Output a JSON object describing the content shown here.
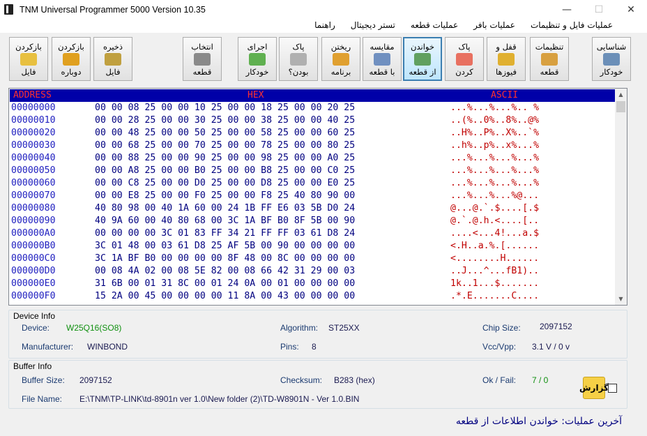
{
  "window": {
    "title": "TNM  Universal Programmer 5000   Version 10.35",
    "minimize_glyph": "—",
    "maximize_glyph": "☐",
    "close_glyph": "✕"
  },
  "menu": {
    "items": [
      "راهنما",
      "تستر دیجیتال",
      "عملیات قطعه",
      "عملیات بافر",
      "عملیات فایل و تنظیمات"
    ]
  },
  "toolbar": {
    "buttons": [
      {
        "l1": "شناسایی",
        "l2": "خودکار",
        "icon": "chip-detect-icon",
        "color": "#6b8fb8"
      },
      {
        "l1": "تنظیمات",
        "l2": "قطعه",
        "icon": "settings-tools-icon",
        "color": "#d8a040"
      },
      {
        "l1": "قفل و",
        "l2": "فیوزها",
        "icon": "lock-icon",
        "color": "#e0b030"
      },
      {
        "l1": "پاک",
        "l2": "کردن",
        "icon": "eraser-icon",
        "color": "#e87060"
      },
      {
        "l1": "خواندن",
        "l2": "از قطعه",
        "icon": "read-chip-icon",
        "color": "#60a060"
      },
      {
        "l1": "مقایسه",
        "l2": "با قطعه",
        "icon": "compare-icon",
        "color": "#7090c0"
      },
      {
        "l1": "ریختن",
        "l2": "برنامه",
        "icon": "write-program-icon",
        "color": "#e0a030"
      },
      {
        "l1": "پاک",
        "l2": "بودن؟",
        "icon": "blank-check-icon",
        "color": "#b0b0b0"
      },
      {
        "l1": "اجرای",
        "l2": "خودکار",
        "icon": "auto-run-icon",
        "color": "#60b050"
      },
      {
        "l1": "انتخاب",
        "l2": "قطعه",
        "icon": "select-chip-icon",
        "color": "#8a8a8a"
      },
      {
        "l1": "ذخیره",
        "l2": "فایل",
        "icon": "save-file-icon",
        "color": "#c0a040"
      },
      {
        "l1": "بازکردن",
        "l2": "دوباره",
        "icon": "reopen-icon",
        "color": "#e0a020"
      },
      {
        "l1": "بازکردن",
        "l2": "فایل",
        "icon": "open-file-icon",
        "color": "#e8c040"
      }
    ]
  },
  "hex_view": {
    "header_address": "ADDRESS",
    "header_hex": "HEX",
    "header_ascii": "ASCII",
    "rows": [
      {
        "addr": "00000000",
        "hex": "00 00 08 25 00 00 10 25 00 00 18 25 00 00 20 25",
        "ascii": "...%...%...%.. %"
      },
      {
        "addr": "00000010",
        "hex": "00 00 28 25 00 00 30 25 00 00 38 25 00 00 40 25",
        "ascii": "..(%..0%..8%..@%"
      },
      {
        "addr": "00000020",
        "hex": "00 00 48 25 00 00 50 25 00 00 58 25 00 00 60 25",
        "ascii": "..H%..P%..X%..`%"
      },
      {
        "addr": "00000030",
        "hex": "00 00 68 25 00 00 70 25 00 00 78 25 00 00 80 25",
        "ascii": "..h%..p%..x%...%"
      },
      {
        "addr": "00000040",
        "hex": "00 00 88 25 00 00 90 25 00 00 98 25 00 00 A0 25",
        "ascii": "...%...%...%...%"
      },
      {
        "addr": "00000050",
        "hex": "00 00 A8 25 00 00 B0 25 00 00 B8 25 00 00 C0 25",
        "ascii": "...%...%...%...%"
      },
      {
        "addr": "00000060",
        "hex": "00 00 C8 25 00 00 D0 25 00 00 D8 25 00 00 E0 25",
        "ascii": "...%...%...%...%"
      },
      {
        "addr": "00000070",
        "hex": "00 00 E8 25 00 00 F0 25 00 00 F8 25 40 80 90 00",
        "ascii": "...%...%...%@..."
      },
      {
        "addr": "00000080",
        "hex": "40 80 98 00 40 1A 60 00 24 1B FF E6 03 5B D0 24",
        "ascii": "@...@.`.$....[.$"
      },
      {
        "addr": "00000090",
        "hex": "40 9A 60 00 40 80 68 00 3C 1A BF B0 8F 5B 00 90",
        "ascii": "@.`.@.h.<....[.."
      },
      {
        "addr": "000000A0",
        "hex": "00 00 00 00 3C 01 83 FF 34 21 FF FF 03 61 D8 24",
        "ascii": "....<...4!...a.$"
      },
      {
        "addr": "000000B0",
        "hex": "3C 01 48 00 03 61 D8 25 AF 5B 00 90 00 00 00 00",
        "ascii": "<.H..a.%.[......"
      },
      {
        "addr": "000000C0",
        "hex": "3C 1A BF B0 00 00 00 00 8F 48 00 8C 00 00 00 00",
        "ascii": "<........H......"
      },
      {
        "addr": "000000D0",
        "hex": "00 08 4A 02 00 08 5E 82 00 08 66 42 31 29 00 03",
        "ascii": "..J...^...fB1).."
      },
      {
        "addr": "000000E0",
        "hex": "31 6B 00 01 31 8C 00 01 24 0A 00 01 00 00 00 00",
        "ascii": "1k..1...$......."
      },
      {
        "addr": "000000F0",
        "hex": "15 2A 00 45 00 00 00 00 11 8A 00 43 00 00 00 00",
        "ascii": ".*.E.......C...."
      }
    ]
  },
  "device_info": {
    "title": "Device Info",
    "device_label": "Device:",
    "device_value": "W25Q16(SO8)",
    "manufacturer_label": "Manufacturer:",
    "manufacturer_value": "WINBOND",
    "algorithm_label": "Algorithm:",
    "algorithm_value": "ST25XX",
    "pins_label": "Pins:",
    "pins_value": "8",
    "chip_size_label": "Chip Size:",
    "chip_size_value": "2097152",
    "vcc_label": "Vcc/Vpp:",
    "vcc_value": "3.1 V / 0 v"
  },
  "buffer_info": {
    "title": "Buffer Info",
    "buffer_size_label": "Buffer Size:",
    "buffer_size_value": "2097152",
    "checksum_label": "Checksum:",
    "checksum_value": "B283 (hex)",
    "okfail_label": "Ok / Fail:",
    "okfail_value": "7 / 0",
    "filename_label": "File Name:",
    "filename_value": "E:\\TNM\\TP-LINK\\td-8901n ver 1.0\\New folder (2)\\TD-W8901N - Ver 1.0.BIN"
  },
  "report": {
    "label": "گزارش"
  },
  "status": {
    "text": "آخرین عملیات:  خواندن اطلاعات از قطعه"
  },
  "colors": {
    "accent": "#0000a8",
    "hex_header_text": "#ff3030",
    "ascii": "#c00000",
    "ok_green": "#109010"
  }
}
